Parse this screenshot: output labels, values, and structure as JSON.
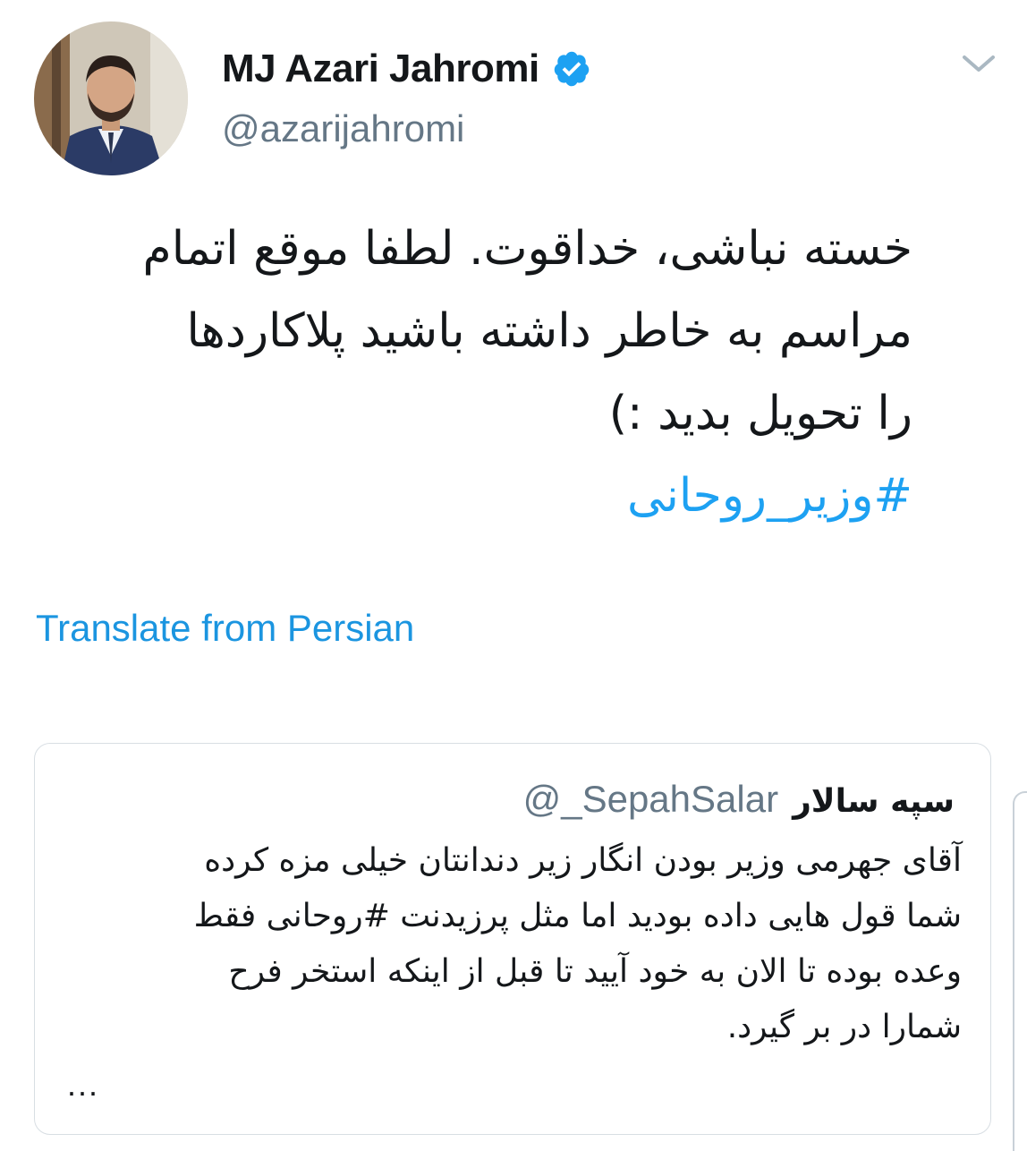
{
  "tweet": {
    "author": {
      "display_name": "MJ Azari Jahromi",
      "handle": "@azarijahromi",
      "verified": true,
      "verified_icon": "verified-badge-icon"
    },
    "menu_icon": "chevron-down-icon",
    "text_lines": [
      "خسته نباشی، خداقوت. لطفا موقع اتمام",
      "مراسم به خاطر داشته باشید پلاکاردها",
      "را تحویل بدید :)"
    ],
    "hashtag": "#وزیر_روحانی",
    "translate_label": "Translate from Persian"
  },
  "quoted_tweet": {
    "author_name": "سپه سالار",
    "handle": "@_SepahSalar",
    "text_lines": [
      "آقای جهرمی وزیر بودن انگار زیر دندانتان خیلی مزه کرده",
      "شما قول هایی داده بودید اما مثل پرزیدنت #روحانی فقط",
      "وعده بوده تا الان به خود آیید تا قبل از اینکه استخر فرح",
      "شمارا در بر گیرد."
    ],
    "ellipsis": "..."
  },
  "colors": {
    "link_blue": "#1b95e0",
    "hashtag_blue": "#1da1f2",
    "secondary_gray": "#657786",
    "text_dark": "#14171a",
    "verified_blue": "#1da1f2"
  }
}
